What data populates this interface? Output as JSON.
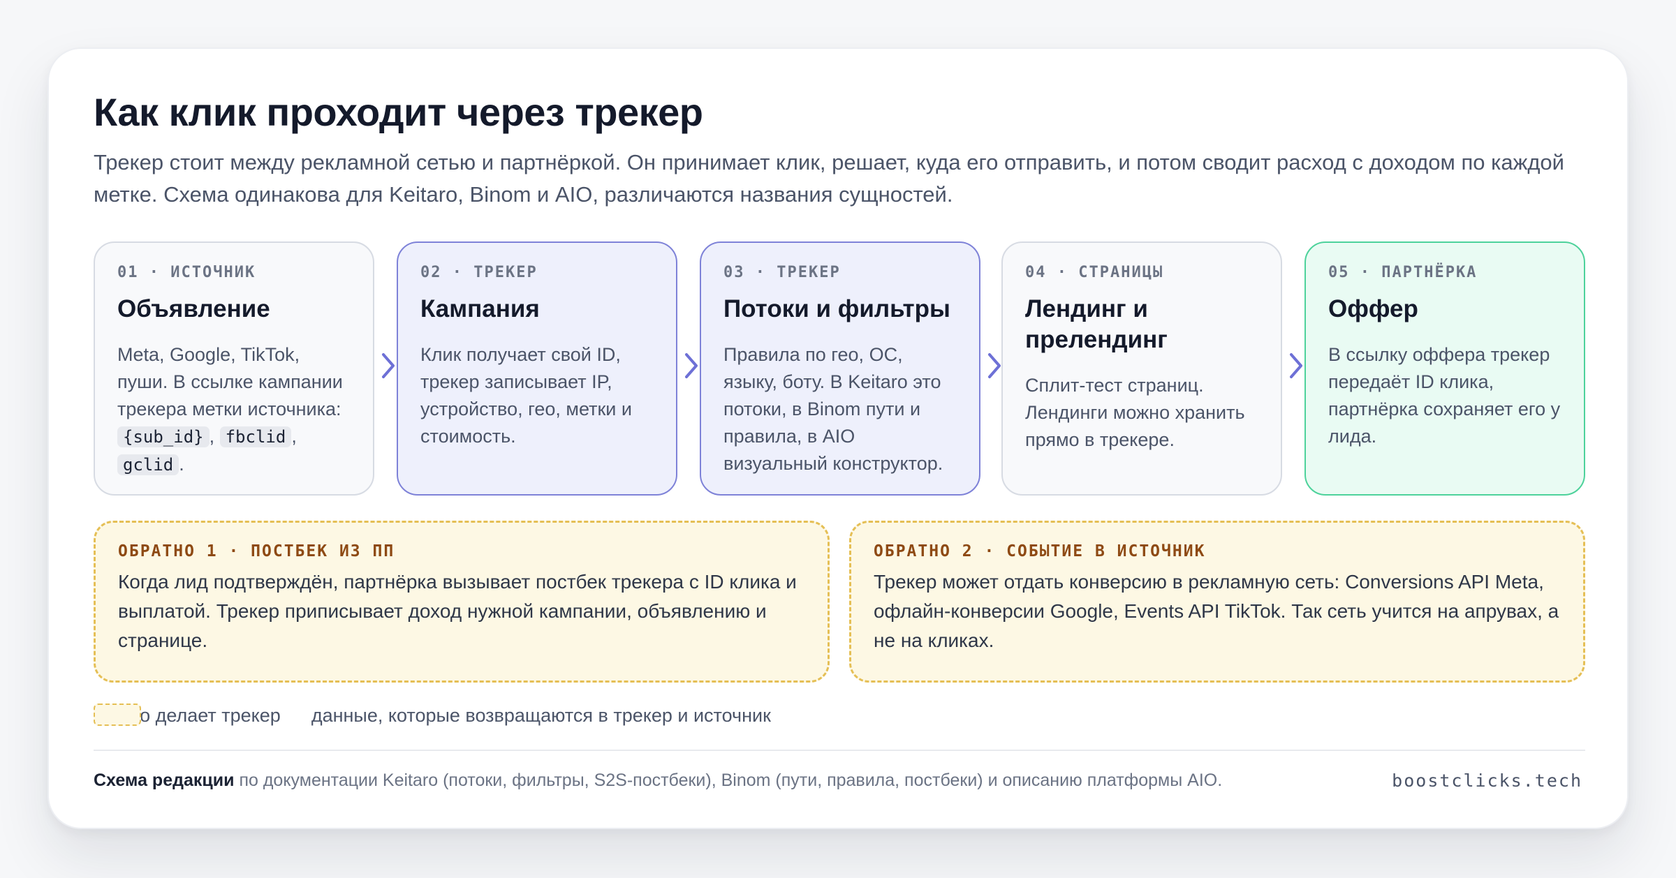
{
  "title": "Как клик проходит через трекер",
  "lead": "Трекер стоит между рекламной сетью и партнёркой. Он принимает клик, решает, куда его отправить, и потом сводит расход с доходом по каждой метке. Схема одинакова для Keitaro, Binom и AIO, различаются названия сущностей.",
  "steps": [
    {
      "tag": "01 · ИСТОЧНИК",
      "title": "Объявление",
      "desc_before": "Meta, Google, TikTok, пуши. В ссылке кампании трекера метки источника: ",
      "code_1": "{sub_id}",
      "sep_1": ", ",
      "code_2": "fbclid",
      "sep_2": ", ",
      "code_3": "gclid",
      "desc_after": ".",
      "kind": "source"
    },
    {
      "tag": "02 · ТРЕКЕР",
      "title": "Кампания",
      "desc": "Клик получает свой ID, трекер записывает IP, устройство, гео, метки и стоимость.",
      "kind": "tracker"
    },
    {
      "tag": "03 · ТРЕКЕР",
      "title": "Потоки и фильтры",
      "desc": "Правила по гео, ОС, языку, боту. В Keitaro это потоки, в Binom пути и правила, в AIO визуальный конструктор.",
      "kind": "tracker"
    },
    {
      "tag": "04 · СТРАНИЦЫ",
      "title": "Лендинг и прелендинг",
      "desc": "Сплит-тест страниц. Лендинги можно хранить прямо в трекере.",
      "kind": "pages"
    },
    {
      "tag": "05 · ПАРТНЁРКА",
      "title": "Оффер",
      "desc": "В ссылку оффера трекер передаёт ID клика, партнёрка сохраняет его у лида.",
      "kind": "offer"
    }
  ],
  "returns": [
    {
      "tag": "ОБРАТНО 1 · ПОСТБЕК ИЗ ПП",
      "desc": "Когда лид подтверждён, партнёрка вызывает постбек трекера с ID клика и выплатой. Трекер приписывает доход нужной кампании, объявлению и странице."
    },
    {
      "tag": "ОБРАТНО 2 · СОБЫТИЕ В ИСТОЧНИК",
      "desc": "Трекер может отдать конверсию в рекламную сеть: Conversions API Meta, офлайн-конверсии Google, Events API TikTok. Так сеть учится на апрувах, а не на кликах."
    }
  ],
  "legend": {
    "tracker": "что делает трекер",
    "returns": "данные, которые возвращаются в трекер и источник"
  },
  "footer": {
    "bold": "Схема редакции",
    "text": " по документации Keitaro (потоки, фильтры, S2S-постбеки), Binom (пути, правила, постбеки) и описанию платформы AIO.",
    "domain": "boostclicks.tech"
  },
  "colors": {
    "tracker_fill": "#eef0fc",
    "tracker_border": "#7e82d8",
    "offer_fill": "#e9fbf3",
    "offer_border": "#4dd29b",
    "return_fill": "#fdf8e4",
    "return_border": "#e5bf55",
    "arrow": "#6d70d6"
  }
}
